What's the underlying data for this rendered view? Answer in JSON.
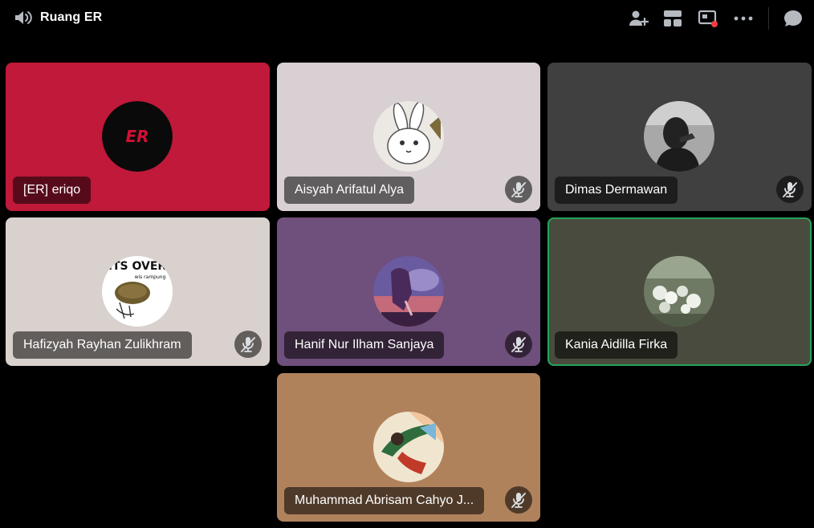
{
  "header": {
    "channel_icon": "voice-channel-icon",
    "title": "Ruang ER",
    "actions": [
      {
        "icon": "add-user-icon"
      },
      {
        "icon": "grid-layout-icon"
      },
      {
        "icon": "screen-share-icon"
      },
      {
        "icon": "more-icon"
      },
      {
        "icon": "chat-icon"
      }
    ]
  },
  "participants": [
    {
      "name": "[ER] eriqo",
      "bg": "#c0193a",
      "muted": false,
      "speaking": false,
      "avatar": "ER logo"
    },
    {
      "name": "Aisyah Arifatul Alya",
      "bg": "#d8d0d3",
      "muted": true,
      "speaking": false,
      "avatar": "rabbit"
    },
    {
      "name": "Dimas Dermawan",
      "bg": "#404040",
      "muted": true,
      "speaking": false,
      "avatar": "person-photo"
    },
    {
      "name": "Hafizyah Rayhan Zulikhram",
      "bg": "#d9d1cd",
      "muted": true,
      "speaking": false,
      "avatar": "ITS OVER meme"
    },
    {
      "name": "Hanif Nur Ilham Sanjaya",
      "bg": "#6f4f7b",
      "muted": true,
      "speaking": false,
      "avatar": "anime-scene"
    },
    {
      "name": "Kania Aidilla Firka",
      "bg": "#4a4b3f",
      "muted": false,
      "speaking": true,
      "avatar": "flowers"
    },
    {
      "name": "Muhammad Abrisam Cahyo J...",
      "bg": "#b0825c",
      "muted": true,
      "speaking": false,
      "avatar": "comic-art"
    }
  ],
  "avatar_text": {
    "er_logo": "ER",
    "meme_line1": "ITS OVER",
    "meme_line2": "wis rampung"
  },
  "colors": {
    "speaking_ring": "#23a559",
    "status_red": "#f23f43"
  }
}
